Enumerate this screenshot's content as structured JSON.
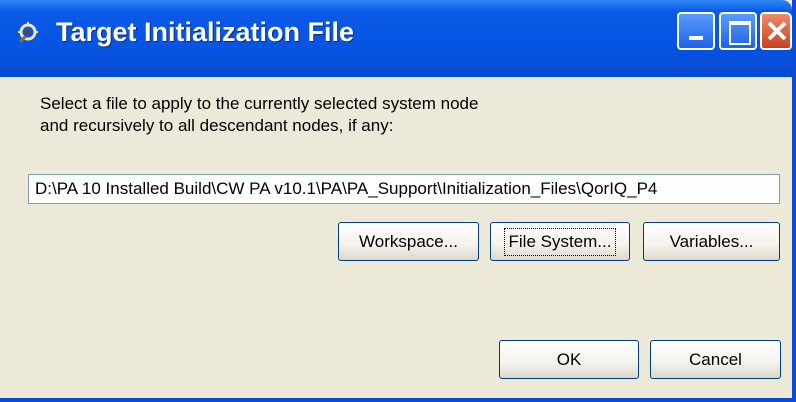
{
  "dialog": {
    "title": "Target Initialization File",
    "icon": "target-gear-icon"
  },
  "titlebar_buttons": {
    "minimize": "minimize-icon",
    "maximize": "maximize-icon",
    "close": "close-icon"
  },
  "description": "Select a file to apply to the currently selected system node\nand recursively to all descendant nodes, if any:",
  "path_field": {
    "value": "D:\\PA 10 Installed Build\\CW PA v10.1\\PA\\PA_Support\\Initialization_Files\\QorIQ_P4"
  },
  "buttons": {
    "workspace": "Workspace...",
    "file_system": "File System...",
    "variables": "Variables...",
    "ok": "OK",
    "cancel": "Cancel"
  },
  "colors": {
    "titlebar": "#0554e3",
    "dialog_bg": "#ece9d8",
    "close_button": "#c8401f"
  }
}
